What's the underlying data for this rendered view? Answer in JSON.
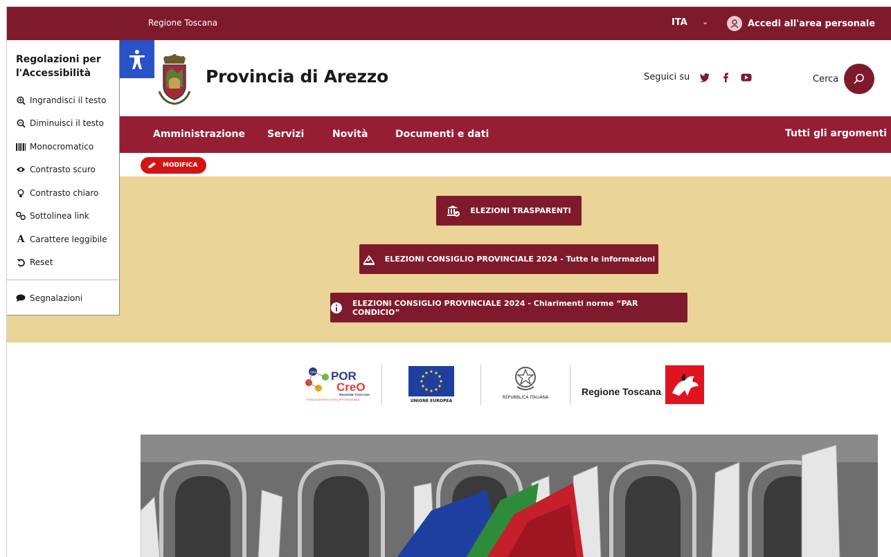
{
  "topbar": {
    "region_link": "Regione Toscana",
    "language": "ITA",
    "login_label": "Accedi all'area personale"
  },
  "header": {
    "site_title": "Provincia di Arezzo",
    "social_label": "Seguici su",
    "social_icons": [
      "twitter-icon",
      "facebook-icon",
      "youtube-icon"
    ],
    "search_label": "Cerca"
  },
  "nav": {
    "items": [
      "Amministrazione",
      "Servizi",
      "Novità",
      "Documenti e dati"
    ],
    "all_topics": "Tutti gli argomenti"
  },
  "edit": {
    "label": "MODIFICA"
  },
  "banner": {
    "buttons": [
      {
        "label": "ELEZIONI TRASPARENTI",
        "icon": "institution-icon"
      },
      {
        "label": "ELEZIONI CONSIGLIO PROVINCIALE 2024 - Tutte le informazioni",
        "icon": "ballot-icon"
      },
      {
        "label": "ELEZIONI CONSIGLIO PROVINCIALE 2024 - Chiarimenti norme “PAR CONDICIO”",
        "icon": "info-icon"
      }
    ]
  },
  "partners": {
    "por_line1": "POR",
    "por_line2": "CreO",
    "por_year": "2014 2020",
    "por_sub": "REGIONE TOSCANA",
    "por_sub2": "FONDO EUROPEO DI SVILUPPO REGIONALE",
    "eu_label": "UNIONE EUROPEA",
    "italy_label": "REPUBBLICA ITALIANA",
    "tuscany_label": "Regione Toscana"
  },
  "accessibility": {
    "title": "Regolazioni per l'Accessibilità",
    "items": [
      {
        "label": "Ingrandisci il testo",
        "icon": "zoom-in-icon"
      },
      {
        "label": "Diminuisci il testo",
        "icon": "zoom-out-icon"
      },
      {
        "label": "Monocromatico",
        "icon": "barcode-icon"
      },
      {
        "label": "Contrasto scuro",
        "icon": "eye-icon"
      },
      {
        "label": "Contrasto chiaro",
        "icon": "lightbulb-icon"
      },
      {
        "label": "Sottolinea link",
        "icon": "link-icon"
      },
      {
        "label": "Carattere leggibile",
        "icon": "font-icon"
      },
      {
        "label": "Reset",
        "icon": "reset-icon"
      }
    ],
    "report": "Segnalazioni"
  },
  "colors": {
    "brand_dark": "#7f1a2c",
    "brand_nav": "#961e33",
    "banner_bg": "#ead497",
    "edit_red": "#d41414",
    "accessibility_blue": "#2952c7"
  }
}
